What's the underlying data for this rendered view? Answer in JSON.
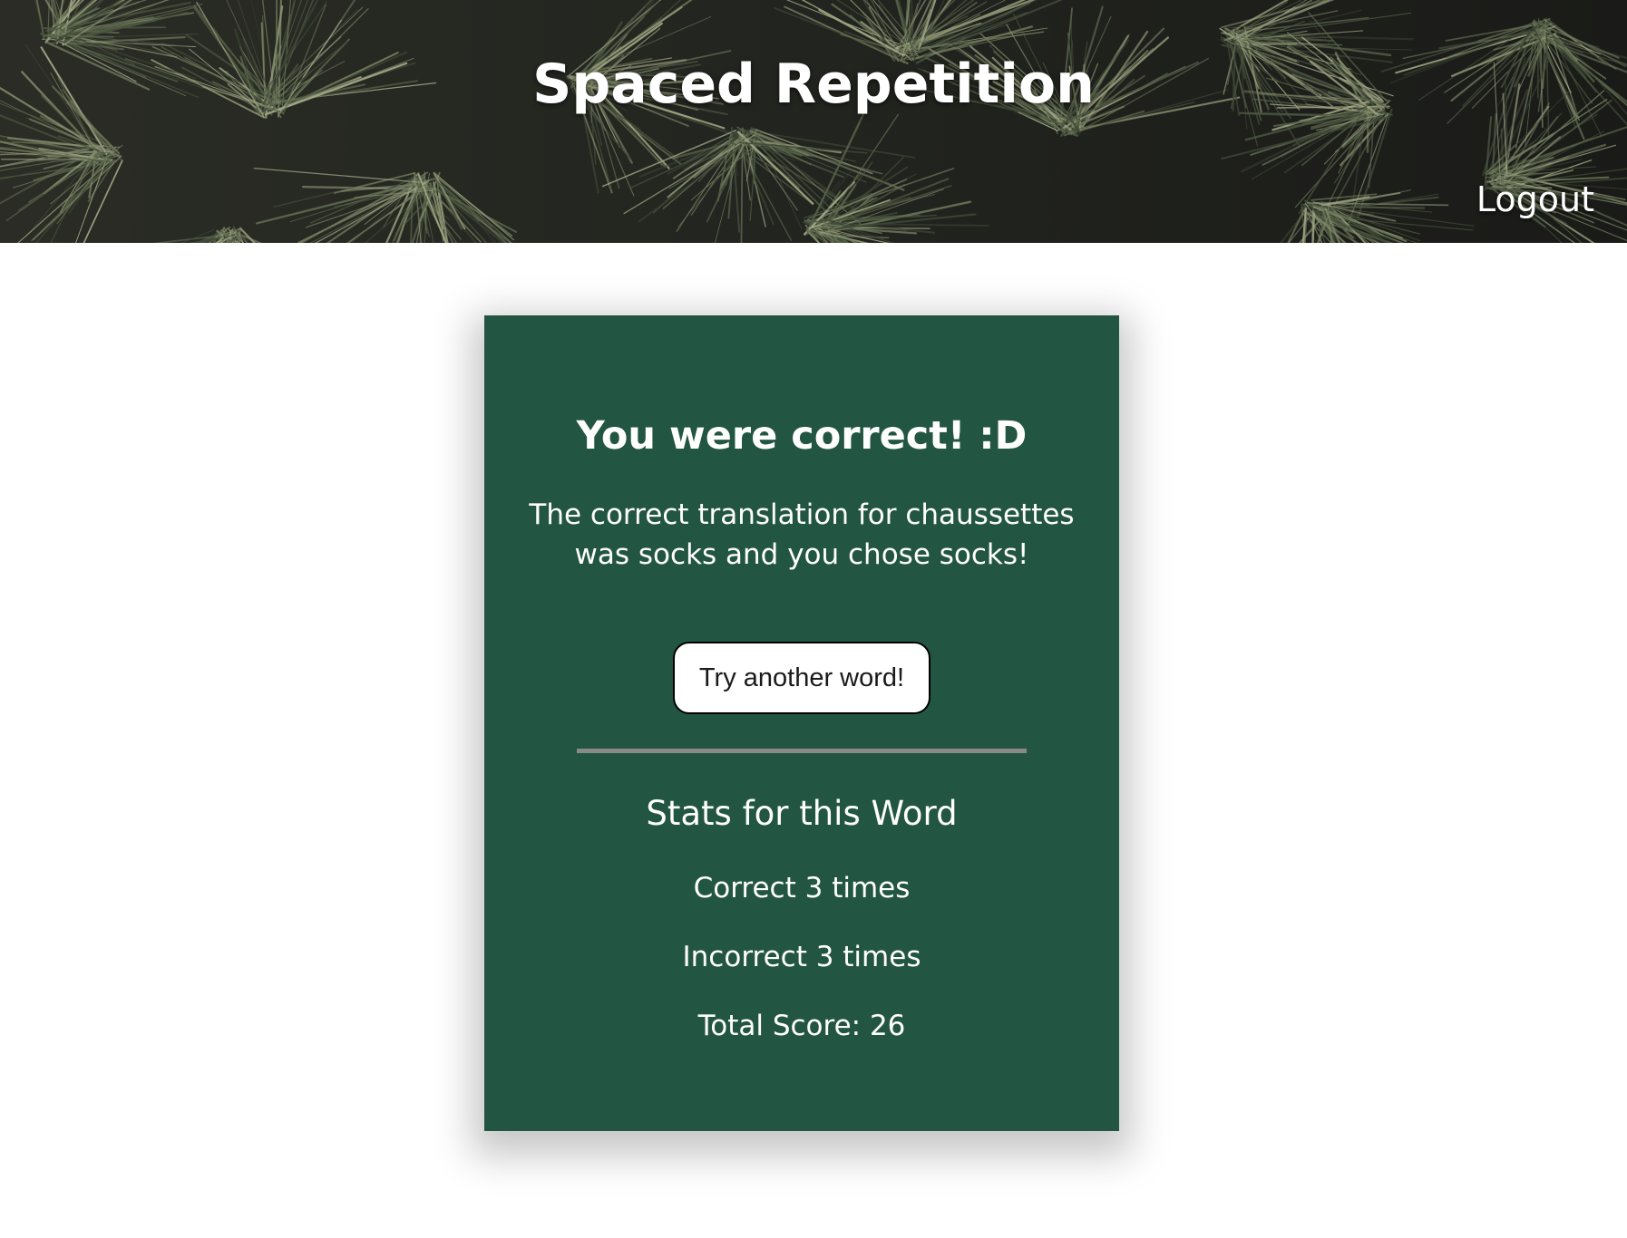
{
  "header": {
    "title": "Spaced Repetition",
    "logout_label": "Logout"
  },
  "result": {
    "heading": "You were correct! :D",
    "message": "The correct translation for chaussettes was socks and you chose socks!",
    "next_button_label": "Try another word!"
  },
  "stats": {
    "heading": "Stats for this Word",
    "correct": "Correct 3 times",
    "incorrect": "Incorrect 3 times",
    "total": "Total Score: 26"
  },
  "colors": {
    "card_background": "#225642",
    "header_background": "#1f1f1b",
    "divider": "#8a8a8a"
  }
}
